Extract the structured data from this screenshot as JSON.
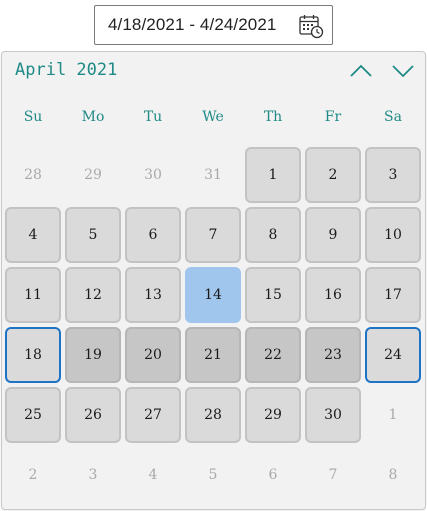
{
  "range_input": {
    "value": "4/18/2021 - 4/24/2021",
    "icon": "calendar-clock-icon"
  },
  "calendar": {
    "title": "April 2021",
    "nav": {
      "prev_icon": "chevron-up-icon",
      "next_icon": "chevron-down-icon"
    },
    "weekdays": [
      "Su",
      "Mo",
      "Tu",
      "We",
      "Th",
      "Fr",
      "Sa"
    ],
    "colors": {
      "accent": "#1f8a86",
      "selection_border": "#1f73c4",
      "today_fill": "#a0c6ee",
      "range_fill": "#c6c6c6",
      "day_fill": "#dadada"
    },
    "weeks": [
      [
        {
          "d": "28",
          "s": "other"
        },
        {
          "d": "29",
          "s": "other"
        },
        {
          "d": "30",
          "s": "other"
        },
        {
          "d": "31",
          "s": "other"
        },
        {
          "d": "1",
          "s": "cur"
        },
        {
          "d": "2",
          "s": "cur"
        },
        {
          "d": "3",
          "s": "cur"
        }
      ],
      [
        {
          "d": "4",
          "s": "cur"
        },
        {
          "d": "5",
          "s": "cur"
        },
        {
          "d": "6",
          "s": "cur"
        },
        {
          "d": "7",
          "s": "cur"
        },
        {
          "d": "8",
          "s": "cur"
        },
        {
          "d": "9",
          "s": "cur"
        },
        {
          "d": "10",
          "s": "cur"
        }
      ],
      [
        {
          "d": "11",
          "s": "cur"
        },
        {
          "d": "12",
          "s": "cur"
        },
        {
          "d": "13",
          "s": "cur"
        },
        {
          "d": "14",
          "s": "today"
        },
        {
          "d": "15",
          "s": "cur"
        },
        {
          "d": "16",
          "s": "cur"
        },
        {
          "d": "17",
          "s": "cur"
        }
      ],
      [
        {
          "d": "18",
          "s": "edge"
        },
        {
          "d": "19",
          "s": "inrange"
        },
        {
          "d": "20",
          "s": "inrange"
        },
        {
          "d": "21",
          "s": "inrange"
        },
        {
          "d": "22",
          "s": "inrange"
        },
        {
          "d": "23",
          "s": "inrange"
        },
        {
          "d": "24",
          "s": "edge"
        }
      ],
      [
        {
          "d": "25",
          "s": "cur"
        },
        {
          "d": "26",
          "s": "cur"
        },
        {
          "d": "27",
          "s": "cur"
        },
        {
          "d": "28",
          "s": "cur"
        },
        {
          "d": "29",
          "s": "cur"
        },
        {
          "d": "30",
          "s": "cur"
        },
        {
          "d": "1",
          "s": "other"
        }
      ],
      [
        {
          "d": "2",
          "s": "other"
        },
        {
          "d": "3",
          "s": "other"
        },
        {
          "d": "4",
          "s": "other"
        },
        {
          "d": "5",
          "s": "other"
        },
        {
          "d": "6",
          "s": "other"
        },
        {
          "d": "7",
          "s": "other"
        },
        {
          "d": "8",
          "s": "other"
        }
      ]
    ]
  }
}
